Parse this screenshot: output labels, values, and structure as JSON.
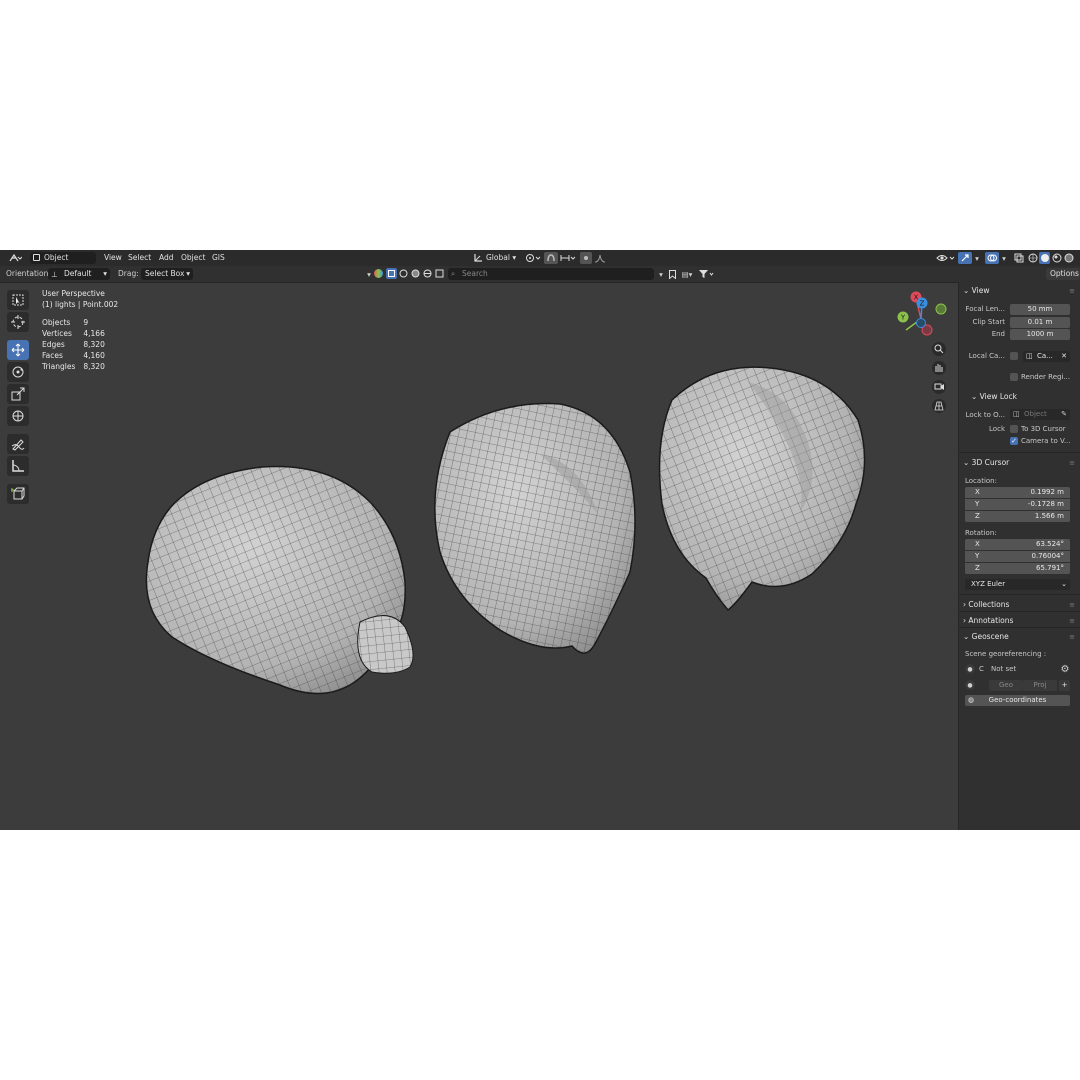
{
  "header": {
    "mode_label": "Object Mode",
    "menus": [
      "View",
      "Select",
      "Add",
      "Object",
      "GIS"
    ],
    "transform_orientation": "Global"
  },
  "tool_header": {
    "orientation_label": "Orientation:",
    "orientation_value": "Default",
    "drag_label": "Drag:",
    "drag_value": "Select Box",
    "search_placeholder": "Search",
    "options_label": "Options"
  },
  "toolbar": {
    "tools": [
      "select-box",
      "cursor",
      "move",
      "rotate",
      "scale",
      "transform",
      "annotate",
      "measure",
      "add-cube"
    ],
    "active": "move"
  },
  "viewport": {
    "view_name": "User Perspective",
    "context": "(1) lights | Point.002",
    "stats": [
      {
        "label": "Objects",
        "value": "9"
      },
      {
        "label": "Vertices",
        "value": "4,166"
      },
      {
        "label": "Edges",
        "value": "8,320"
      },
      {
        "label": "Faces",
        "value": "4,160"
      },
      {
        "label": "Triangles",
        "value": "8,320"
      }
    ],
    "gizmo_axes": {
      "x": "X",
      "y": "Y",
      "z": "Z"
    }
  },
  "sidebar": {
    "view_title": "View",
    "focal_label": "Focal Len...",
    "focal_value": "50 mm",
    "clip_start_label": "Clip Start",
    "clip_start_value": "0.01 m",
    "clip_end_label": "End",
    "clip_end_value": "1000 m",
    "local_camera_label": "Local Ca...",
    "local_camera_value": "Ca...",
    "render_region_label": "Render Regi...",
    "view_lock_title": "View Lock",
    "lock_to_object_label": "Lock to O...",
    "lock_to_object_placeholder": "Object",
    "lock_label": "Lock",
    "to_3d_cursor_label": "To 3D Cursor",
    "camera_to_view_label": "Camera to V...",
    "cursor_title": "3D Cursor",
    "location_label": "Location:",
    "location": [
      {
        "axis": "X",
        "value": "0.1992 m"
      },
      {
        "axis": "Y",
        "value": "-0.1728 m"
      },
      {
        "axis": "Z",
        "value": "1.566 m"
      }
    ],
    "rotation_label": "Rotation:",
    "rotation": [
      {
        "axis": "X",
        "value": "63.524°"
      },
      {
        "axis": "Y",
        "value": "0.76004°"
      },
      {
        "axis": "Z",
        "value": "65.791°"
      }
    ],
    "rotation_mode": "XYZ Euler",
    "collections_title": "Collections",
    "annotations_title": "Annotations",
    "geoscene_title": "Geoscene",
    "georef_label": "Scene georeferencing :",
    "crs_prefix": "C",
    "crs_value": "Not set",
    "geo_label": "Geo",
    "proj_label": "Proj",
    "geocoords_label": "Geo-coordinates"
  },
  "colors": {
    "viewport_bg": "#3c3c3c",
    "header_bg": "#2b2b2b",
    "accent": "#4772b3",
    "axis_x": "#e04a5a",
    "axis_y": "#8bc34a",
    "axis_z": "#3a8fe0"
  }
}
